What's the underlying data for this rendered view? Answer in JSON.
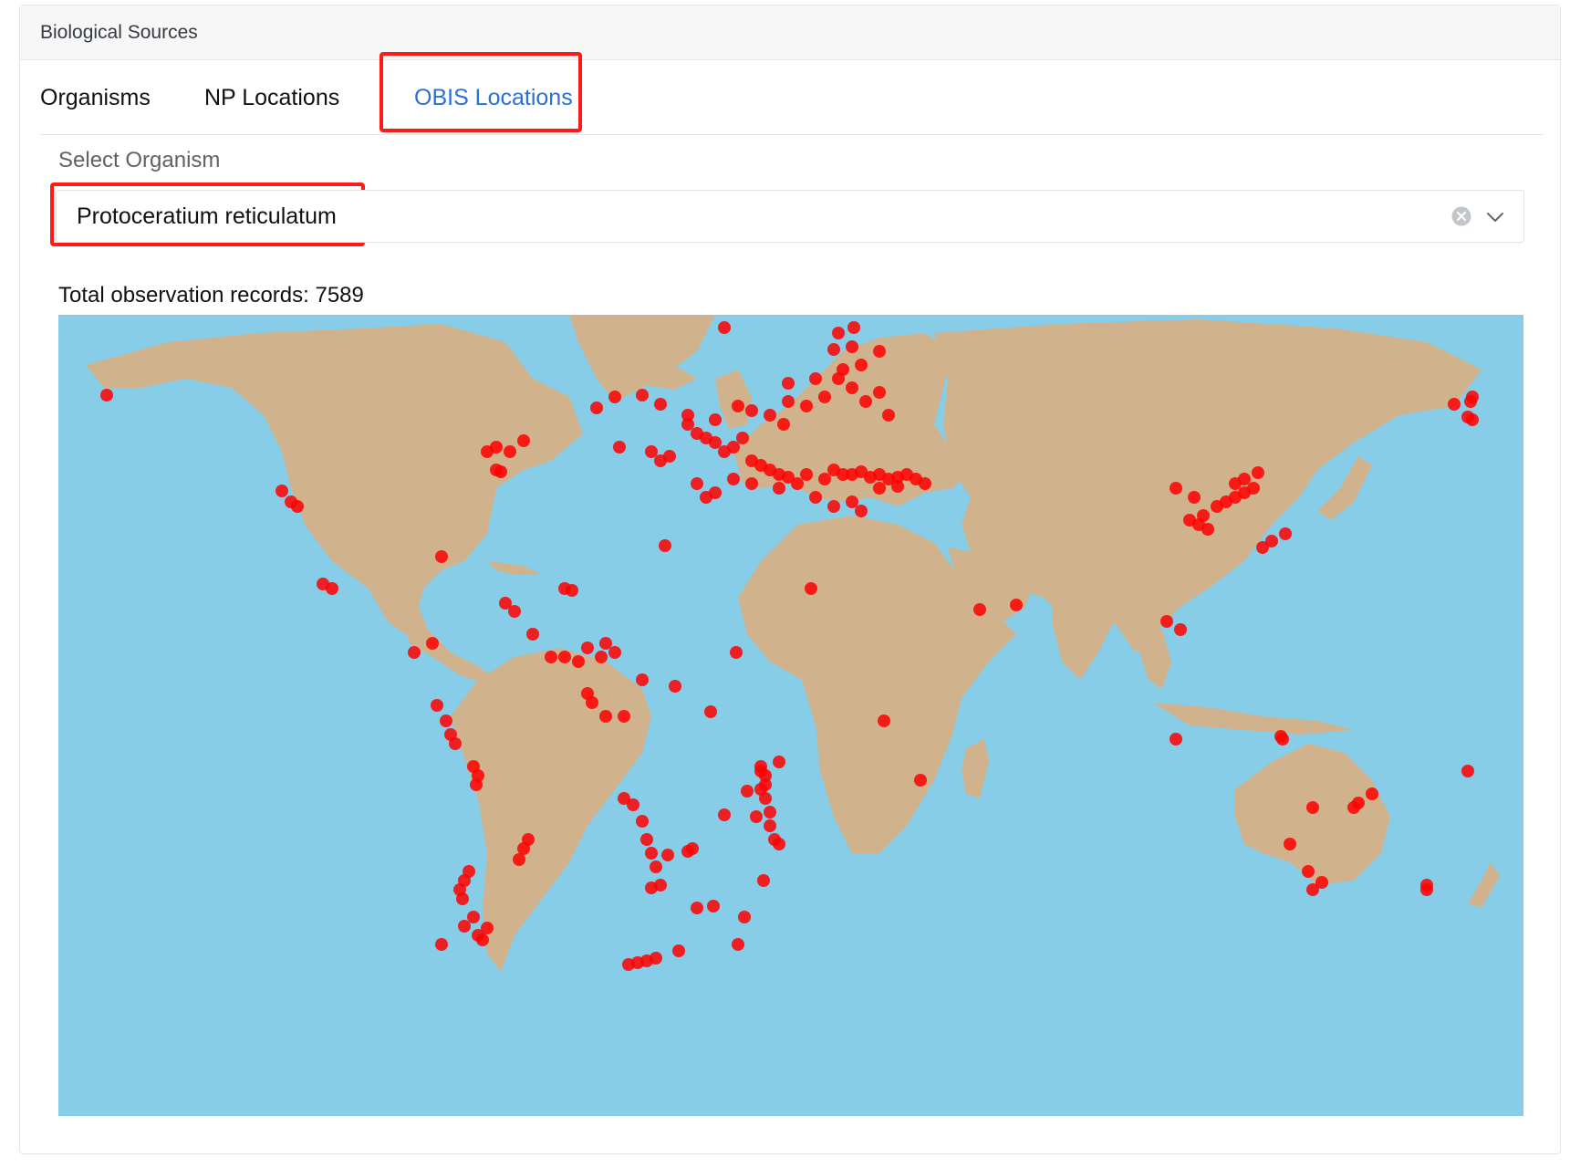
{
  "card": {
    "title": "Biological Sources"
  },
  "tabs": [
    {
      "label": "Organisms",
      "active": false
    },
    {
      "label": "NP Locations",
      "active": false
    },
    {
      "label": "OBIS Locations",
      "active": true
    }
  ],
  "select_organism": {
    "label": "Select Organism",
    "value": "Protoceratium reticulatum"
  },
  "total_records": "Total observation records: 7589",
  "map": {
    "ocean_color": "#87cde8",
    "land_color": "#d0b38d",
    "point_color": "#ff0000",
    "observation_count": 7589
  }
}
